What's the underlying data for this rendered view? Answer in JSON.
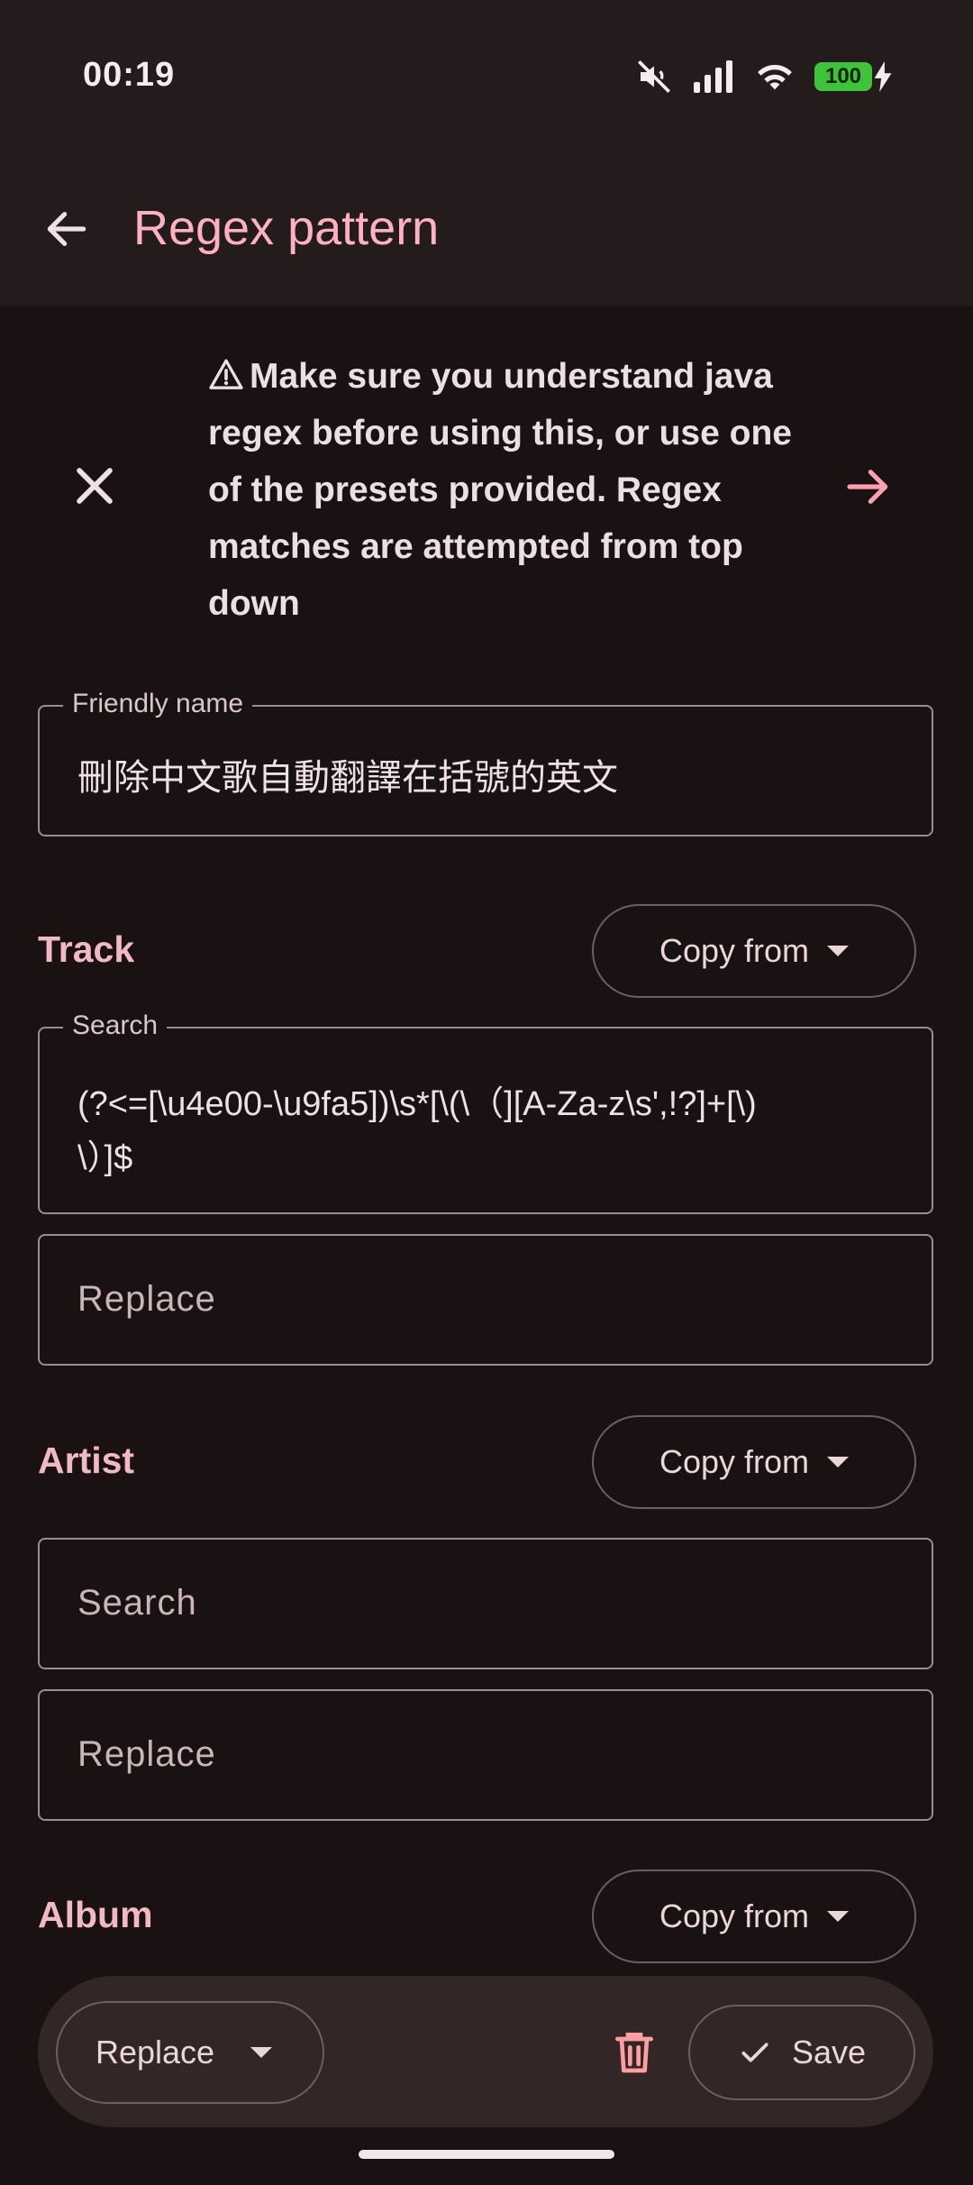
{
  "status_bar": {
    "time": "00:19",
    "battery": "100"
  },
  "app_bar": {
    "title": "Regex pattern"
  },
  "banner": {
    "text": "Make sure you understand java regex before using this, or use one of the presets provided. Regex matches are attempted from top down"
  },
  "friendly_name": {
    "label": "Friendly name",
    "value": "刪除中文歌自動翻譯在括號的英文"
  },
  "track": {
    "label": "Track",
    "copy_from": "Copy from",
    "search_label": "Search",
    "search_value_line1": "(?<=[\\u4e00-\\u9fa5])\\s*[\\(\\（][A-Za-z\\s',!?]+[\\)",
    "search_value_line2": "\\）]$",
    "replace_placeholder": "Replace"
  },
  "artist": {
    "label": "Artist",
    "copy_from": "Copy from",
    "search_placeholder": "Search",
    "replace_placeholder": "Replace"
  },
  "album": {
    "label": "Album",
    "copy_from": "Copy from"
  },
  "bottom_bar": {
    "mode": "Replace",
    "save": "Save"
  },
  "colors": {
    "accent": "#ffb1c0",
    "background": "#191112",
    "surface": "#231b1c",
    "battery": "#3ec33a"
  }
}
